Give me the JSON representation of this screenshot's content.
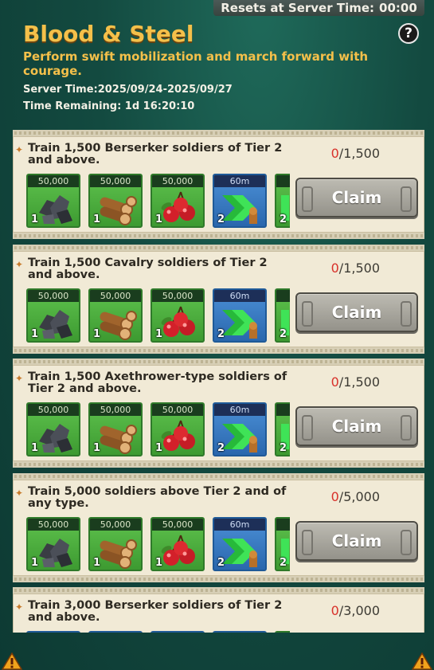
{
  "header": {
    "reset_text": "Resets at Server Time:",
    "reset_time": "00:00",
    "title": "Blood & Steel",
    "subtitle": "Perform swift mobilization and march forward with courage.",
    "server_time": "Server Time:2025/09/24-2025/09/27",
    "time_remaining": "Time Remaining: 1d 16:20:10"
  },
  "icons": {
    "help": "question-mark-icon",
    "warning": "warning-icon",
    "bullet": "diamond-bullet-icon"
  },
  "colors": {
    "title": "#f4c04a",
    "progress_current": "#d8312a",
    "reward_green": "#4aae3d",
    "reward_blue": "#3a7bc4"
  },
  "tasks": [
    {
      "desc": "Train 1,500 Berserker soldiers of Tier 2 and above.",
      "current": "0",
      "target": "/1,500",
      "claim_label": "Claim",
      "rewards": [
        {
          "amount": "50,000",
          "count": "1",
          "icon": "iron-ore-icon",
          "tier": "green"
        },
        {
          "amount": "50,000",
          "count": "1",
          "icon": "wood-logs-icon",
          "tier": "green"
        },
        {
          "amount": "50,000",
          "count": "1",
          "icon": "cherries-food-icon",
          "tier": "green"
        },
        {
          "amount": "60m",
          "count": "2",
          "icon": "training-speedup-icon",
          "tier": "blue"
        },
        {
          "amount": "",
          "count": "2",
          "icon": "partial-reward-icon",
          "tier": "green"
        }
      ]
    },
    {
      "desc": "Train 1,500 Cavalry soldiers of Tier 2 and above.",
      "current": "0",
      "target": "/1,500",
      "claim_label": "Claim",
      "rewards": [
        {
          "amount": "50,000",
          "count": "1",
          "icon": "iron-ore-icon",
          "tier": "green"
        },
        {
          "amount": "50,000",
          "count": "1",
          "icon": "wood-logs-icon",
          "tier": "green"
        },
        {
          "amount": "50,000",
          "count": "1",
          "icon": "cherries-food-icon",
          "tier": "green"
        },
        {
          "amount": "60m",
          "count": "2",
          "icon": "training-speedup-icon",
          "tier": "blue"
        },
        {
          "amount": "",
          "count": "2",
          "icon": "partial-reward-icon",
          "tier": "green"
        }
      ]
    },
    {
      "desc": "Train 1,500 Axethrower-type soldiers of Tier 2 and above.",
      "current": "0",
      "target": "/1,500",
      "claim_label": "Claim",
      "rewards": [
        {
          "amount": "50,000",
          "count": "1",
          "icon": "iron-ore-icon",
          "tier": "green"
        },
        {
          "amount": "50,000",
          "count": "1",
          "icon": "wood-logs-icon",
          "tier": "green"
        },
        {
          "amount": "50,000",
          "count": "1",
          "icon": "cherries-food-icon",
          "tier": "green"
        },
        {
          "amount": "60m",
          "count": "2",
          "icon": "training-speedup-icon",
          "tier": "blue"
        },
        {
          "amount": "",
          "count": "2",
          "icon": "partial-reward-icon",
          "tier": "green"
        }
      ]
    },
    {
      "desc": "Train 5,000 soldiers above Tier 2 and of any type.",
      "current": "0",
      "target": "/5,000",
      "claim_label": "Claim",
      "rewards": [
        {
          "amount": "50,000",
          "count": "1",
          "icon": "iron-ore-icon",
          "tier": "green"
        },
        {
          "amount": "50,000",
          "count": "1",
          "icon": "wood-logs-icon",
          "tier": "green"
        },
        {
          "amount": "50,000",
          "count": "1",
          "icon": "cherries-food-icon",
          "tier": "green"
        },
        {
          "amount": "60m",
          "count": "2",
          "icon": "training-speedup-icon",
          "tier": "blue"
        },
        {
          "amount": "",
          "count": "2",
          "icon": "partial-reward-icon",
          "tier": "green"
        }
      ]
    },
    {
      "desc": "Train 3,000 Berserker soldiers of Tier 2 and above.",
      "current": "0",
      "target": "/3,000",
      "claim_label": "",
      "rewards": [
        {
          "amount": "",
          "count": "",
          "icon": "reward-slot-icon",
          "tier": "blue"
        },
        {
          "amount": "",
          "count": "",
          "icon": "reward-slot-icon",
          "tier": "blue"
        },
        {
          "amount": "",
          "count": "",
          "icon": "reward-slot-icon",
          "tier": "blue"
        },
        {
          "amount": "",
          "count": "",
          "icon": "reward-slot-icon",
          "tier": "blue"
        },
        {
          "amount": "",
          "count": "",
          "icon": "reward-slot-icon",
          "tier": "green"
        }
      ]
    }
  ]
}
